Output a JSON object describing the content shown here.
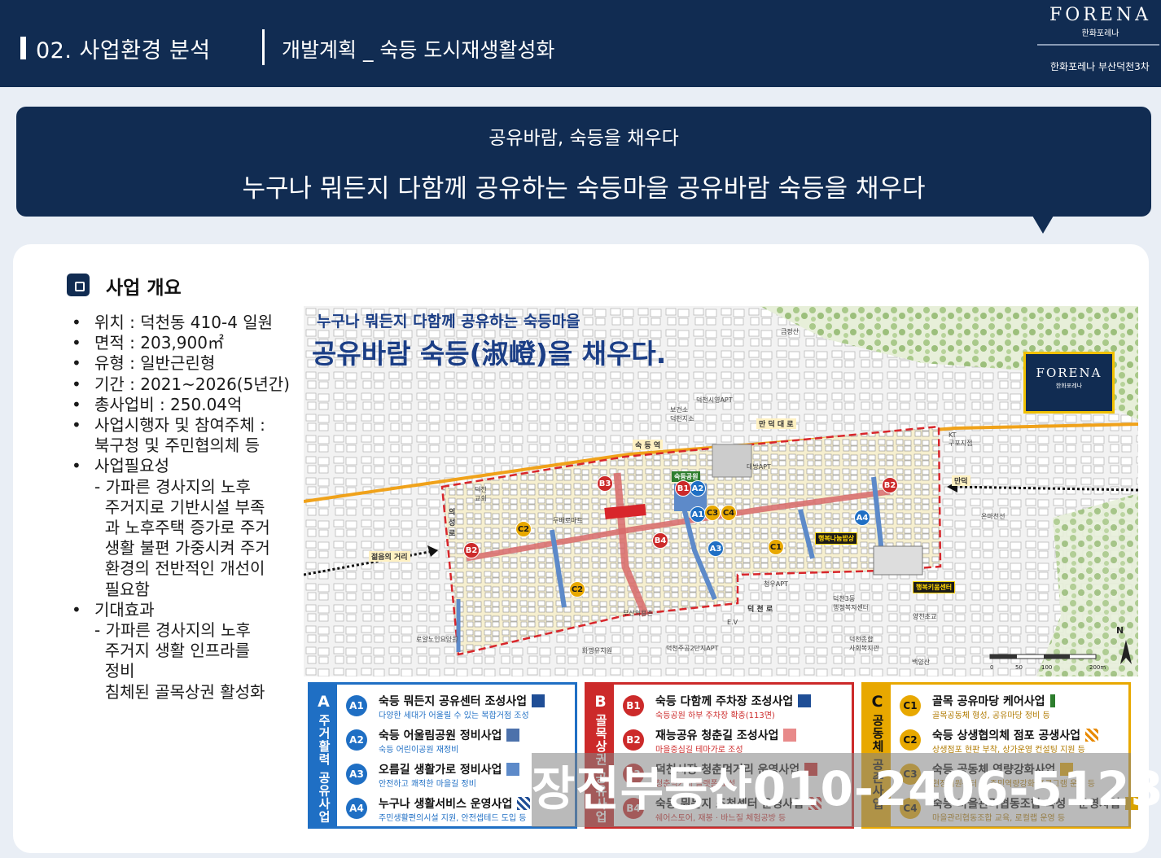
{
  "header": {
    "section": "02. 사업환경 분석",
    "subtitle": "개발계획 _ 숙등 도시재생활성화",
    "brand_logo": "FORENA",
    "brand_sub": "한화포레나",
    "project": "한화포레나 부산덕천3차"
  },
  "banner": {
    "kicker": "공유바람, 숙등을 채우다",
    "headline": "누구나 뭐든지 다함께 공유하는 숙등마을 공유바람 숙등을 채우다"
  },
  "overview": {
    "title": "사업 개요",
    "items": [
      {
        "text": "위치 : 덕천동 410-4 일원",
        "subs": []
      },
      {
        "text": "면적 : 203,900㎡",
        "subs": []
      },
      {
        "text": "유형 : 일반근린형",
        "subs": []
      },
      {
        "text": "기간 : 2021~2026(5년간)",
        "subs": []
      },
      {
        "text": "총사업비 : 250.04억",
        "subs": []
      },
      {
        "text": "사업시행자 및 참여주체 :\n북구청 및 주민협의체 등",
        "subs": []
      },
      {
        "text": "사업필요성",
        "subs": [
          "- 가파른 경사지의 노후\n  주거지로 기반시설 부족\n  과 노후주택 증가로 주거\n  생활 불편 가중시켜 주거\n  환경의 전반적인 개선이\n  필요함"
        ]
      },
      {
        "text": "기대효과",
        "subs": [
          "- 가파른 경사지의 노후\n  주거지 생활 인프라를\n  정비\n  침체된 골목상권 활성화"
        ]
      }
    ]
  },
  "map": {
    "hand_line1": "누구나 뭐든지 다함께 공유하는 숙등마을",
    "hand_line2": "공유바람 숙등(淑嶝)을 채우다.",
    "logo": "FORENA",
    "logo_sub": "한화포레나",
    "roads": [
      "만 덕 대 로",
      "숙 등 역",
      "덕 천 로",
      "만덕",
      "젊음의 거리"
    ],
    "places": [
      "금정산",
      "보건소\n덕천지소",
      "덕천시영APT",
      "KT\n구포지점",
      "대방APT",
      "온마천선",
      "청우APT",
      "덕천3동\n행정복지센터",
      "양천초교",
      "덕천종합\n사회복지관",
      "백양산",
      "화명유치원",
      "덕천주공2단지APT",
      "로얄노인요양원",
      "부산의용촌",
      "두배로마트",
      "덕천\n교회",
      "의\n성\n로",
      "E.V"
    ],
    "tags": [
      "숙등공원",
      "행복나눔밥상",
      "행복키움센터"
    ],
    "pins": [
      "A1",
      "A2",
      "A3",
      "A4",
      "B1",
      "B2",
      "B2",
      "B3",
      "B4",
      "C1",
      "C2",
      "C2",
      "C3",
      "C4"
    ],
    "north": "N",
    "scale": [
      "0",
      "50",
      "100",
      "200m"
    ]
  },
  "categories": [
    {
      "letter": "A",
      "title": "주거활력 공유사업",
      "items": [
        {
          "code": "A1",
          "name": "숙등 뭐든지 공유센터 조성사업",
          "desc": "다양한 세대가 어울릴 수 있는 복합거점 조성"
        },
        {
          "code": "A2",
          "name": "숙등 어울림공원 정비사업",
          "desc": "숙등 어린이공원 재정비"
        },
        {
          "code": "A3",
          "name": "오름길 생활가로 정비사업",
          "desc": "안전하고 쾌적한 마을길 정비"
        },
        {
          "code": "A4",
          "name": "누구나 생활서비스 운영사업",
          "desc": "주민생활편의시설 지원, 안전셉테드 도입 등"
        }
      ]
    },
    {
      "letter": "B",
      "title": "골목상권 공유사업",
      "items": [
        {
          "code": "B1",
          "name": "숙등 다함께 주차장 조성사업",
          "desc": "숙등공원 하부 주차장 확충(113면)"
        },
        {
          "code": "B2",
          "name": "재능공유 청춘길 조성사업",
          "desc": "마을중심길 테마가로 조성"
        },
        {
          "code": "B3",
          "name": "덕천시장 청춘먹거리 운영사업",
          "desc": "청춘먹거리 플랫폼 조성"
        },
        {
          "code": "B4",
          "name": "숙등 뭐든지 조천센터 운영사업",
          "desc": "쉐어스토어, 재봉 · 바느질 체험공방 등"
        }
      ]
    },
    {
      "letter": "C",
      "title": "공동체 공존사업",
      "items": [
        {
          "code": "C1",
          "name": "골목 공유마당 케어사업",
          "desc": "골목공동체 형성, 공유마당 정비 등"
        },
        {
          "code": "C2",
          "name": "숙등 상생협의체 점포 공생사업",
          "desc": "상생점포 현판 부착, 상가운영 컨설팅 지원 등"
        },
        {
          "code": "C3",
          "name": "숙등 공동체 역량강화사업",
          "desc": "현장지원센터 및 주민역량강화 프로그램 운영 등"
        },
        {
          "code": "C4",
          "name": "숙등 마을관리협동조합 육성 · 운영사업",
          "desc": "마을관리협동조합 교육, 로컬랩 운영 등"
        }
      ]
    }
  ],
  "watermark": "장전부동산010-2406-5123",
  "colors": {
    "navy": "#112c52",
    "catA": "#1f6fc4",
    "catB": "#cc2a2a",
    "catC": "#e8a800"
  }
}
